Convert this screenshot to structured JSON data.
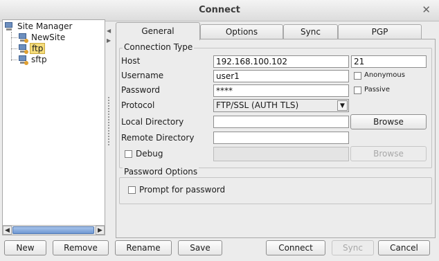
{
  "window": {
    "title": "Connect"
  },
  "tree": {
    "root": "Site Manager",
    "items": [
      "NewSite",
      "ftp",
      "sftp"
    ],
    "selected": "ftp"
  },
  "tabs": [
    "General",
    "Options",
    "Sync",
    "PGP"
  ],
  "active_tab": "General",
  "connection": {
    "group_title": "Connection Type",
    "host_label": "Host",
    "host_value": "192.168.100.102",
    "port_value": "21",
    "username_label": "Username",
    "username_value": "user1",
    "anonymous_label": "Anonymous",
    "password_label": "Password",
    "password_value": "****",
    "passive_label": "Passive",
    "protocol_label": "Protocol",
    "protocol_value": "FTP/SSL (AUTH TLS)",
    "local_dir_label": "Local Directory",
    "local_dir_value": "",
    "browse_label": "Browse",
    "remote_dir_label": "Remote Directory",
    "remote_dir_value": "",
    "debug_label": "Debug",
    "debug_value": "",
    "browse2_label": "Browse"
  },
  "password_options": {
    "group_title": "Password Options",
    "prompt_label": "Prompt for password"
  },
  "buttons": {
    "new": "New",
    "remove": "Remove",
    "rename": "Rename",
    "save": "Save",
    "connect": "Connect",
    "sync": "Sync",
    "cancel": "Cancel"
  },
  "icons": {
    "close": "close-icon",
    "site": "computer-icon",
    "dropdown": "chevron-down-icon"
  }
}
